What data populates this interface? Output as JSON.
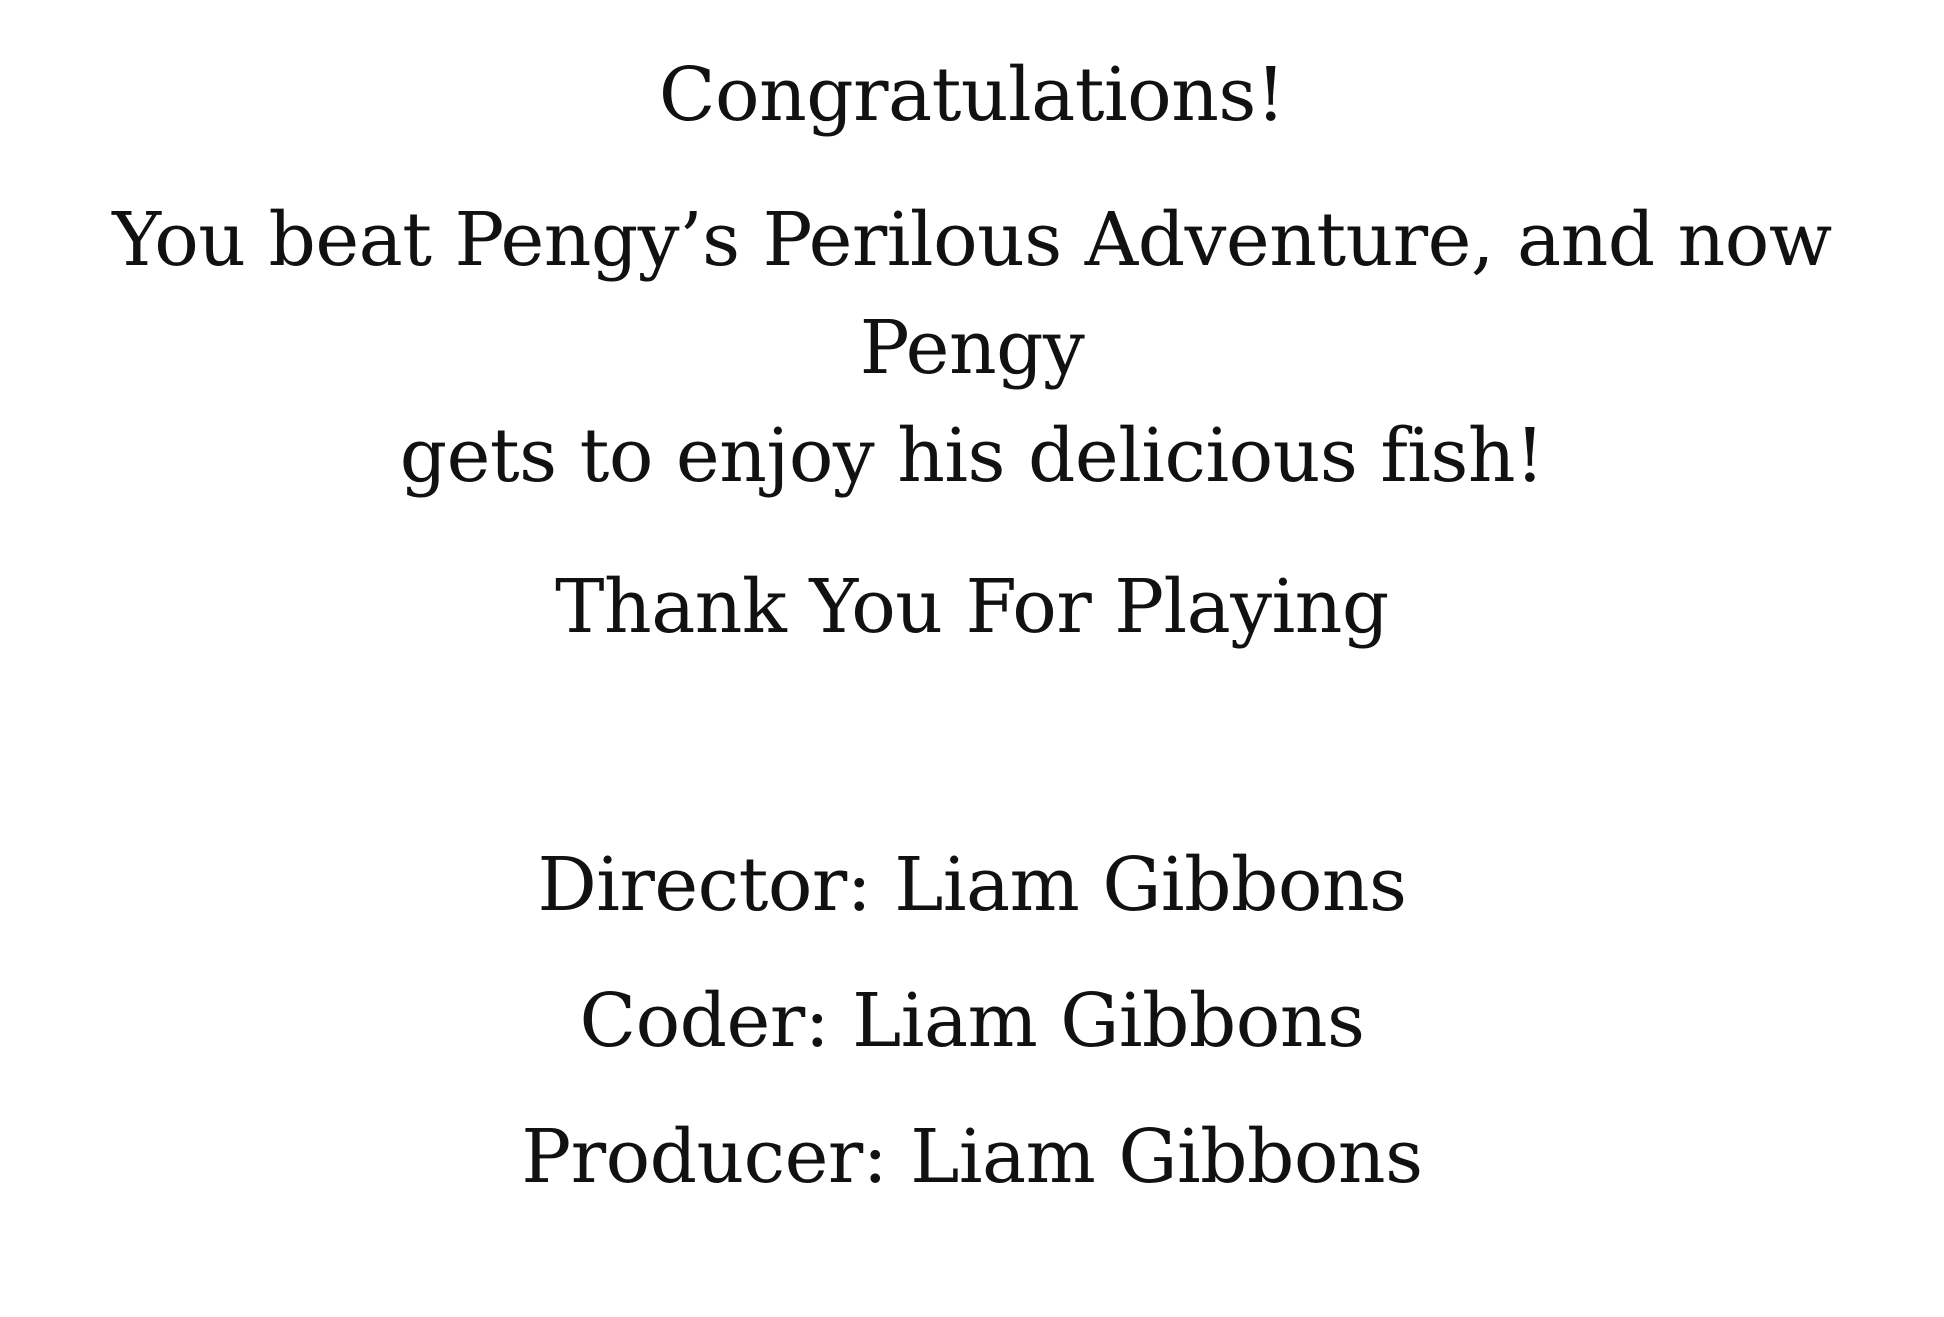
{
  "ending_screen": {
    "heading": "Congratulations!",
    "message_line_1": "You beat Pengy’s Perilous Adventure, and now Pengy",
    "message_line_2": "gets to enjoy his delicious fish!",
    "thanks": "Thank You For Playing",
    "credits": [
      "Director: Liam Gibbons",
      "Coder: Liam Gibbons",
      "Producer: Liam Gibbons"
    ]
  },
  "colors": {
    "background": "#ffffff",
    "text": "#111111"
  }
}
